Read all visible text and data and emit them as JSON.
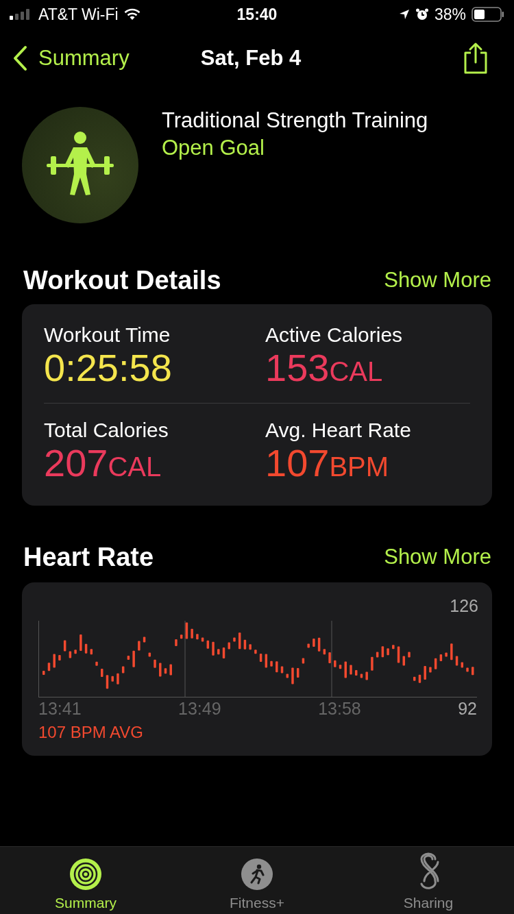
{
  "status_bar": {
    "carrier": "AT&T Wi-Fi",
    "time": "15:40",
    "battery": "38%"
  },
  "nav": {
    "back": "Summary",
    "title": "Sat, Feb 4"
  },
  "workout": {
    "name": "Traditional Strength Training",
    "goal": "Open Goal"
  },
  "workout_details": {
    "title": "Workout Details",
    "action": "Show More",
    "metrics": [
      {
        "label": "Workout Time",
        "value": "0:25:58",
        "color": "#f4e54d"
      },
      {
        "label": "Active Calories",
        "value": "153",
        "unit": "CAL",
        "color": "#ea3a5c"
      },
      {
        "label": "Total Calories",
        "value": "207",
        "unit": "CAL",
        "color": "#ea3a5c"
      },
      {
        "label": "Avg. Heart Rate",
        "value": "107",
        "unit": "BPM",
        "color": "#f2492f"
      }
    ]
  },
  "heart_rate": {
    "title": "Heart Rate",
    "action": "Show More",
    "max": "126",
    "min": "92",
    "times": [
      "13:41",
      "13:49",
      "13:58"
    ],
    "average": "107 BPM AVG"
  },
  "tabs": [
    {
      "label": "Summary",
      "selected": true
    },
    {
      "label": "Fitness+",
      "selected": false
    },
    {
      "label": "Sharing",
      "selected": false
    }
  ]
}
